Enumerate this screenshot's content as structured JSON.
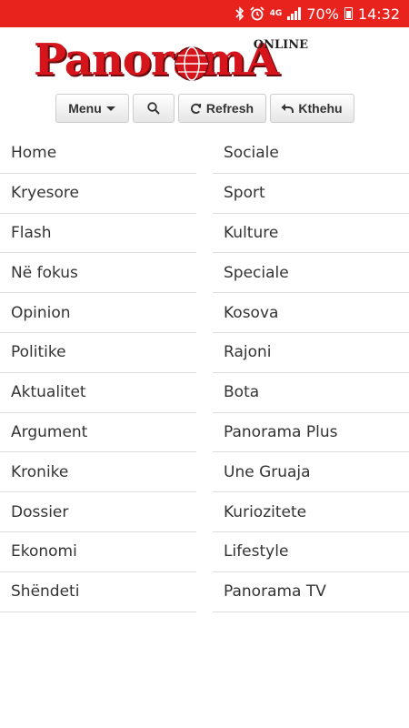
{
  "status_bar": {
    "network": "4G",
    "battery": "70%",
    "time": "14:32",
    "icons": [
      "bluetooth-icon",
      "alarm-icon",
      "signal-icon",
      "battery-icon"
    ]
  },
  "logo": {
    "text": "PanoramA",
    "tag": "ONLINE"
  },
  "toolbar": {
    "menu_label": "Menu",
    "refresh_label": "Refresh",
    "back_label": "Kthehu"
  },
  "nav": {
    "left": [
      "Home",
      "Kryesore",
      "Flash",
      "Në fokus",
      "Opinion",
      "Politike",
      "Aktualitet",
      "Argument",
      "Kronike",
      "Dossier",
      "Ekonomi",
      "Shëndeti"
    ],
    "right": [
      "Sociale",
      "Sport",
      "Kulture",
      "Speciale",
      "Kosova",
      "Rajoni",
      "Bota",
      "Panorama Plus",
      "Une Gruaja",
      "Kuriozitete",
      "Lifestyle",
      "Panorama TV"
    ]
  },
  "colors": {
    "status_bar": "#e8231e",
    "brand_red": "#d5141b",
    "divider": "#dddddd"
  }
}
